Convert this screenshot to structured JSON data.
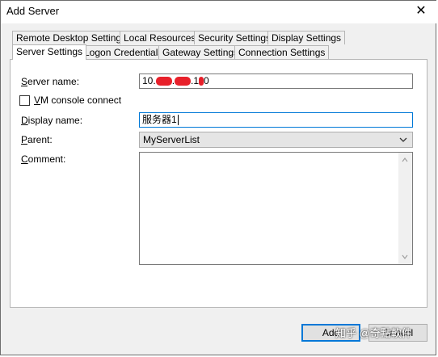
{
  "window": {
    "title": "Add Server"
  },
  "tabs": {
    "row1": [
      "Remote Desktop Settings",
      "Local Resources",
      "Security Settings",
      "Display Settings"
    ],
    "row2": [
      "Server Settings",
      "Logon Credentials",
      "Gateway Settings",
      "Connection Settings"
    ],
    "active": "Server Settings"
  },
  "form": {
    "server_name_label_pre": "",
    "server_name_label_key": "S",
    "server_name_label_post": "erver name:",
    "server_name_parts": [
      "10.",
      ".",
      ".1",
      "0"
    ],
    "vm_label_key": "V",
    "vm_label_post": "M console connect",
    "display_name_label_key": "D",
    "display_name_label_post": "isplay name:",
    "display_name_value": "服务器1",
    "parent_label_key": "P",
    "parent_label_post": "arent:",
    "parent_value": "MyServerList",
    "comment_label_key": "C",
    "comment_label_post": "omment:"
  },
  "buttons": {
    "add": "Add",
    "cancel": "Cancel"
  },
  "watermark": "知乎 @奇點軟件",
  "colors": {
    "focus": "#0078d7",
    "redaction": "#e8202a"
  }
}
